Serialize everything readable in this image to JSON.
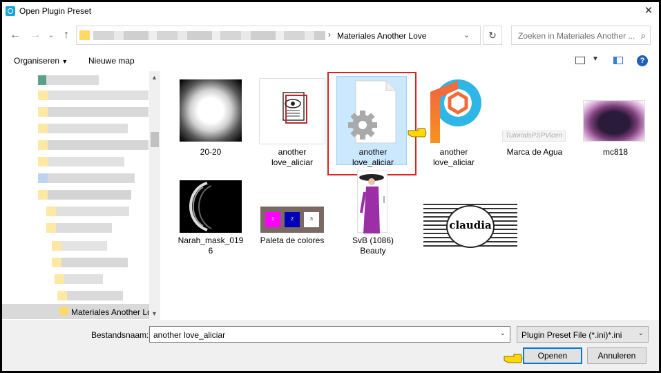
{
  "window": {
    "title": "Open Plugin Preset"
  },
  "nav": {
    "crumb_sep": "›",
    "current_folder": "Materiales Another Love",
    "search_placeholder": "Zoeken in Materiales Another ..."
  },
  "toolbar": {
    "organize": "Organiseren",
    "new_folder": "Nieuwe map"
  },
  "sidebar": {
    "selected": "Materiales Another Love"
  },
  "files": [
    {
      "label": "20-20"
    },
    {
      "label": "another\nlove_aliciar"
    },
    {
      "label": "another\nlove_aliciar"
    },
    {
      "label": "another\nlove_aliciar"
    },
    {
      "label": "Marca de Agua"
    },
    {
      "label": "mc818"
    },
    {
      "label": "Narah_mask_019\n6"
    },
    {
      "label": "Paleta de colores"
    },
    {
      "label": "SvB (1086)\nBeauty"
    },
    {
      "label": ""
    }
  ],
  "thumb_text": {
    "watermark": "TutorialsPSPVicen",
    "claudia": "claudia",
    "palette_numbers": [
      "1",
      "2",
      "3"
    ]
  },
  "bottom": {
    "filename_label": "Bestandsnaam:",
    "filename_value": "another love_aliciar",
    "filetype": "Plugin Preset File (*.ini)*.ini",
    "open": "Openen",
    "cancel": "Annuleren"
  },
  "colors": {
    "accent": "#0078d7",
    "selection": "#cce8ff",
    "highlight_frame": "#e02020"
  }
}
